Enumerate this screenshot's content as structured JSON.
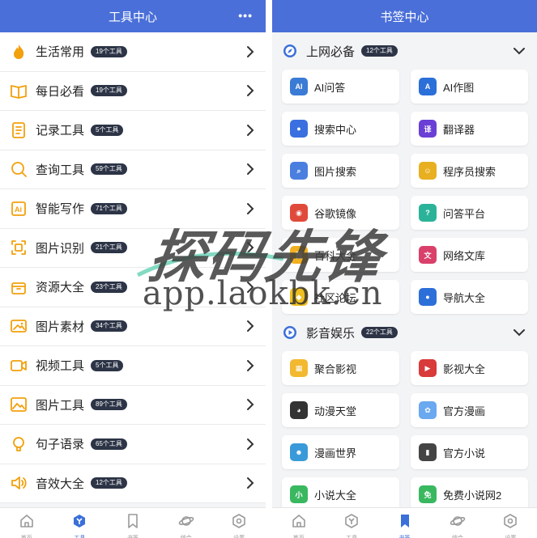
{
  "left": {
    "title": "工具中心",
    "more_icon": "more-dots-icon",
    "tools": [
      {
        "label": "生活常用",
        "badge": "19个工具",
        "icon": "flame-icon",
        "color": "#f2a00c"
      },
      {
        "label": "每日必看",
        "badge": "19个工具",
        "icon": "book-open-icon",
        "color": "#f2a00c"
      },
      {
        "label": "记录工具",
        "badge": "5个工具",
        "icon": "notebook-icon",
        "color": "#f2a00c"
      },
      {
        "label": "查询工具",
        "badge": "59个工具",
        "icon": "search-icon",
        "color": "#f2a00c"
      },
      {
        "label": "智能写作",
        "badge": "71个工具",
        "icon": "ai-write-icon",
        "color": "#f2a00c"
      },
      {
        "label": "图片识别",
        "badge": "21个工具",
        "icon": "scan-icon",
        "color": "#f2a00c"
      },
      {
        "label": "资源大全",
        "badge": "23个工具",
        "icon": "box-icon",
        "color": "#f2a00c"
      },
      {
        "label": "图片素材",
        "badge": "34个工具",
        "icon": "image-icon",
        "color": "#f2a00c"
      },
      {
        "label": "视频工具",
        "badge": "5个工具",
        "icon": "video-icon",
        "color": "#f2a00c"
      },
      {
        "label": "图片工具",
        "badge": "89个工具",
        "icon": "picture-icon",
        "color": "#f2a00c"
      },
      {
        "label": "句子语录",
        "badge": "65个工具",
        "icon": "quote-icon",
        "color": "#f2a00c"
      },
      {
        "label": "音效大全",
        "badge": "12个工具",
        "icon": "speaker-icon",
        "color": "#f2a00c"
      }
    ],
    "nav": [
      {
        "label": "首页",
        "icon": "home-icon",
        "active": false
      },
      {
        "label": "工具",
        "icon": "tools-icon",
        "active": true
      },
      {
        "label": "书签",
        "icon": "bookmark-icon",
        "active": false
      },
      {
        "label": "综合",
        "icon": "planet-icon",
        "active": false
      },
      {
        "label": "设置",
        "icon": "settings-icon",
        "active": false
      }
    ]
  },
  "right": {
    "title": "书签中心",
    "sections": [
      {
        "title": "上网必备",
        "badge": "12个工具",
        "icon": "compass-icon",
        "items": [
          {
            "label": "AI问答",
            "icon": "ai-chat-icon",
            "color": "#3a7bd5"
          },
          {
            "label": "AI作图",
            "icon": "ai-draw-icon",
            "color": "#2b6fd9"
          },
          {
            "label": "搜索中心",
            "icon": "search-center-icon",
            "color": "#3a6fe0"
          },
          {
            "label": "翻译器",
            "icon": "translate-icon",
            "color": "#6a3fd6"
          },
          {
            "label": "图片搜索",
            "icon": "image-search-icon",
            "color": "#4a7fe0"
          },
          {
            "label": "程序员搜索",
            "icon": "coder-search-icon",
            "color": "#e8b020"
          },
          {
            "label": "谷歌镜像",
            "icon": "chrome-icon",
            "color": "#e04a3a"
          },
          {
            "label": "问答平台",
            "icon": "qa-icon",
            "color": "#2bb39a"
          },
          {
            "label": "百科大全",
            "icon": "encyclopedia-icon",
            "color": "#f0b020"
          },
          {
            "label": "网络文库",
            "icon": "library-icon",
            "color": "#d9406a"
          },
          {
            "label": "社区论坛",
            "icon": "forum-icon",
            "color": "#f0c020"
          },
          {
            "label": "导航大全",
            "icon": "map-pin-icon",
            "color": "#2c6fd9"
          }
        ]
      },
      {
        "title": "影音娱乐",
        "badge": "22个工具",
        "icon": "play-circle-icon",
        "items": [
          {
            "label": "聚合影视",
            "icon": "clapper-icon",
            "color": "#f2b930"
          },
          {
            "label": "影视大全",
            "icon": "play-icon",
            "color": "#d93a3a"
          },
          {
            "label": "动漫天堂",
            "icon": "anime-icon",
            "color": "#333333"
          },
          {
            "label": "官方漫画",
            "icon": "comic-icon",
            "color": "#6aa8f0"
          },
          {
            "label": "漫画世界",
            "icon": "manga-icon",
            "color": "#3a9ad9"
          },
          {
            "label": "官方小说",
            "icon": "novel-icon",
            "color": "#444444"
          },
          {
            "label": "小说大全",
            "icon": "novels-icon",
            "color": "#3ab860"
          },
          {
            "label": "免费小说网2",
            "icon": "free-novel-icon",
            "color": "#3ab860"
          }
        ]
      }
    ],
    "nav": [
      {
        "label": "首页",
        "icon": "home-icon",
        "active": false
      },
      {
        "label": "工具",
        "icon": "tools-icon",
        "active": false
      },
      {
        "label": "书签",
        "icon": "bookmark-icon",
        "active": true
      },
      {
        "label": "综合",
        "icon": "planet-icon",
        "active": false
      },
      {
        "label": "设置",
        "icon": "settings-icon",
        "active": false
      }
    ]
  },
  "watermark": {
    "brand": "探码先锋",
    "url": "app.laokbk.cn"
  },
  "colors": {
    "header_blue": "#4a6fd9",
    "badge_dark": "#2c3446",
    "icon_orange": "#f2a00c",
    "nav_active": "#3b6fd9"
  }
}
